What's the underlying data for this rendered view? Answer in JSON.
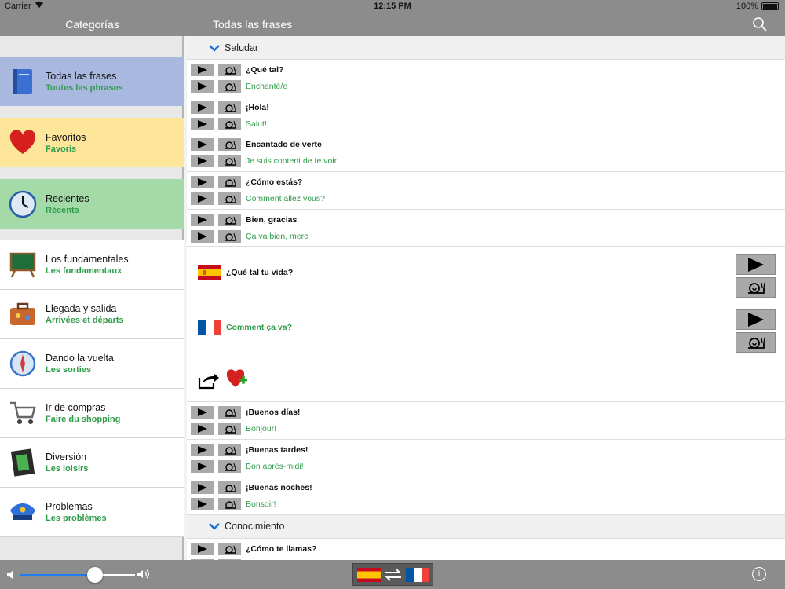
{
  "status": {
    "carrier": "Carrier",
    "time": "12:15 PM",
    "battery": "100%"
  },
  "nav": {
    "left_title": "Categorías",
    "right_title": "Todas las frases"
  },
  "sidebar": {
    "highlighted": [
      {
        "label": "Todas las frases",
        "sub": "Toutes les phrases",
        "bg": "#a9b8df",
        "icon": "book-icon"
      },
      {
        "label": "Favoritos",
        "sub": "Favoris",
        "bg": "#fde59a",
        "icon": "heart-icon"
      },
      {
        "label": "Recientes",
        "sub": "Récents",
        "bg": "#a4d9a8",
        "icon": "clock-icon"
      }
    ],
    "items": [
      {
        "label": "Los fundamentales",
        "sub": "Les fondamentaux",
        "icon": "chalkboard-icon"
      },
      {
        "label": "Llegada y salida",
        "sub": "Arrivées et départs",
        "icon": "suitcase-icon"
      },
      {
        "label": "Dando la vuelta",
        "sub": "Les sorties",
        "icon": "compass-icon"
      },
      {
        "label": "Ir de compras",
        "sub": "Faire du shopping",
        "icon": "cart-icon"
      },
      {
        "label": "Diversión",
        "sub": "Les loisirs",
        "icon": "film-icon"
      },
      {
        "label": "Problemas",
        "sub": "Les problèmes",
        "icon": "police-hat-icon"
      }
    ]
  },
  "main": {
    "section1": "Saludar",
    "phrases1": [
      {
        "es": "¿Qué tal?",
        "fr": "Enchanté/e"
      },
      {
        "es": "¡Hola!",
        "fr": "Salut!"
      },
      {
        "es": "Encantado de verte",
        "fr": "Je suis content de te voir"
      },
      {
        "es": "¿Cómo estás?",
        "fr": "Comment allez vous?"
      },
      {
        "es": "Bien, gracias",
        "fr": "Ça va bien, merci"
      }
    ],
    "detail": {
      "es": "¿Qué tal tu vida?",
      "fr": "Comment ça va?"
    },
    "phrases2": [
      {
        "es": "¡Buenos días!",
        "fr": "Bonjour!"
      },
      {
        "es": "¡Buenas tardes!",
        "fr": "Bon après-midi!"
      },
      {
        "es": "¡Buenas noches!",
        "fr": "Bonsoir!"
      }
    ],
    "section2": "Conocimiento",
    "phrases3": [
      {
        "es": "¿Cómo te llamas?",
        "fr": ""
      }
    ]
  },
  "bottom": {
    "volume": 0.65
  },
  "colors": {
    "accent_green": "#2f9c4a",
    "accent_blue": "#1e7df0",
    "bar_gray": "#8c8c8c"
  }
}
